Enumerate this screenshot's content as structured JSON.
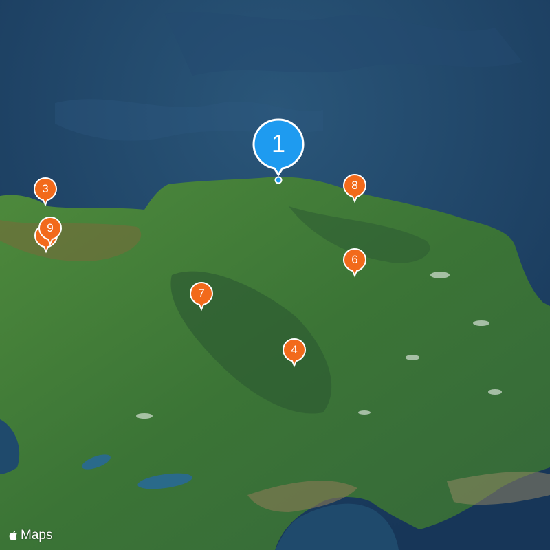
{
  "attribution": {
    "text": "Maps",
    "icon": "apple-icon"
  },
  "colors": {
    "ocean": "#1d3f63",
    "land": "#3f7a3a",
    "selected_pin": "#1e9bf0",
    "pin": "#f26a1b"
  },
  "pins": [
    {
      "label": "1",
      "selected": true
    },
    {
      "label": "3",
      "selected": false
    },
    {
      "label": "9",
      "selected": false
    },
    {
      "label": "8",
      "selected": false
    },
    {
      "label": "6",
      "selected": false
    },
    {
      "label": "7",
      "selected": false
    },
    {
      "label": "4",
      "selected": false
    }
  ]
}
